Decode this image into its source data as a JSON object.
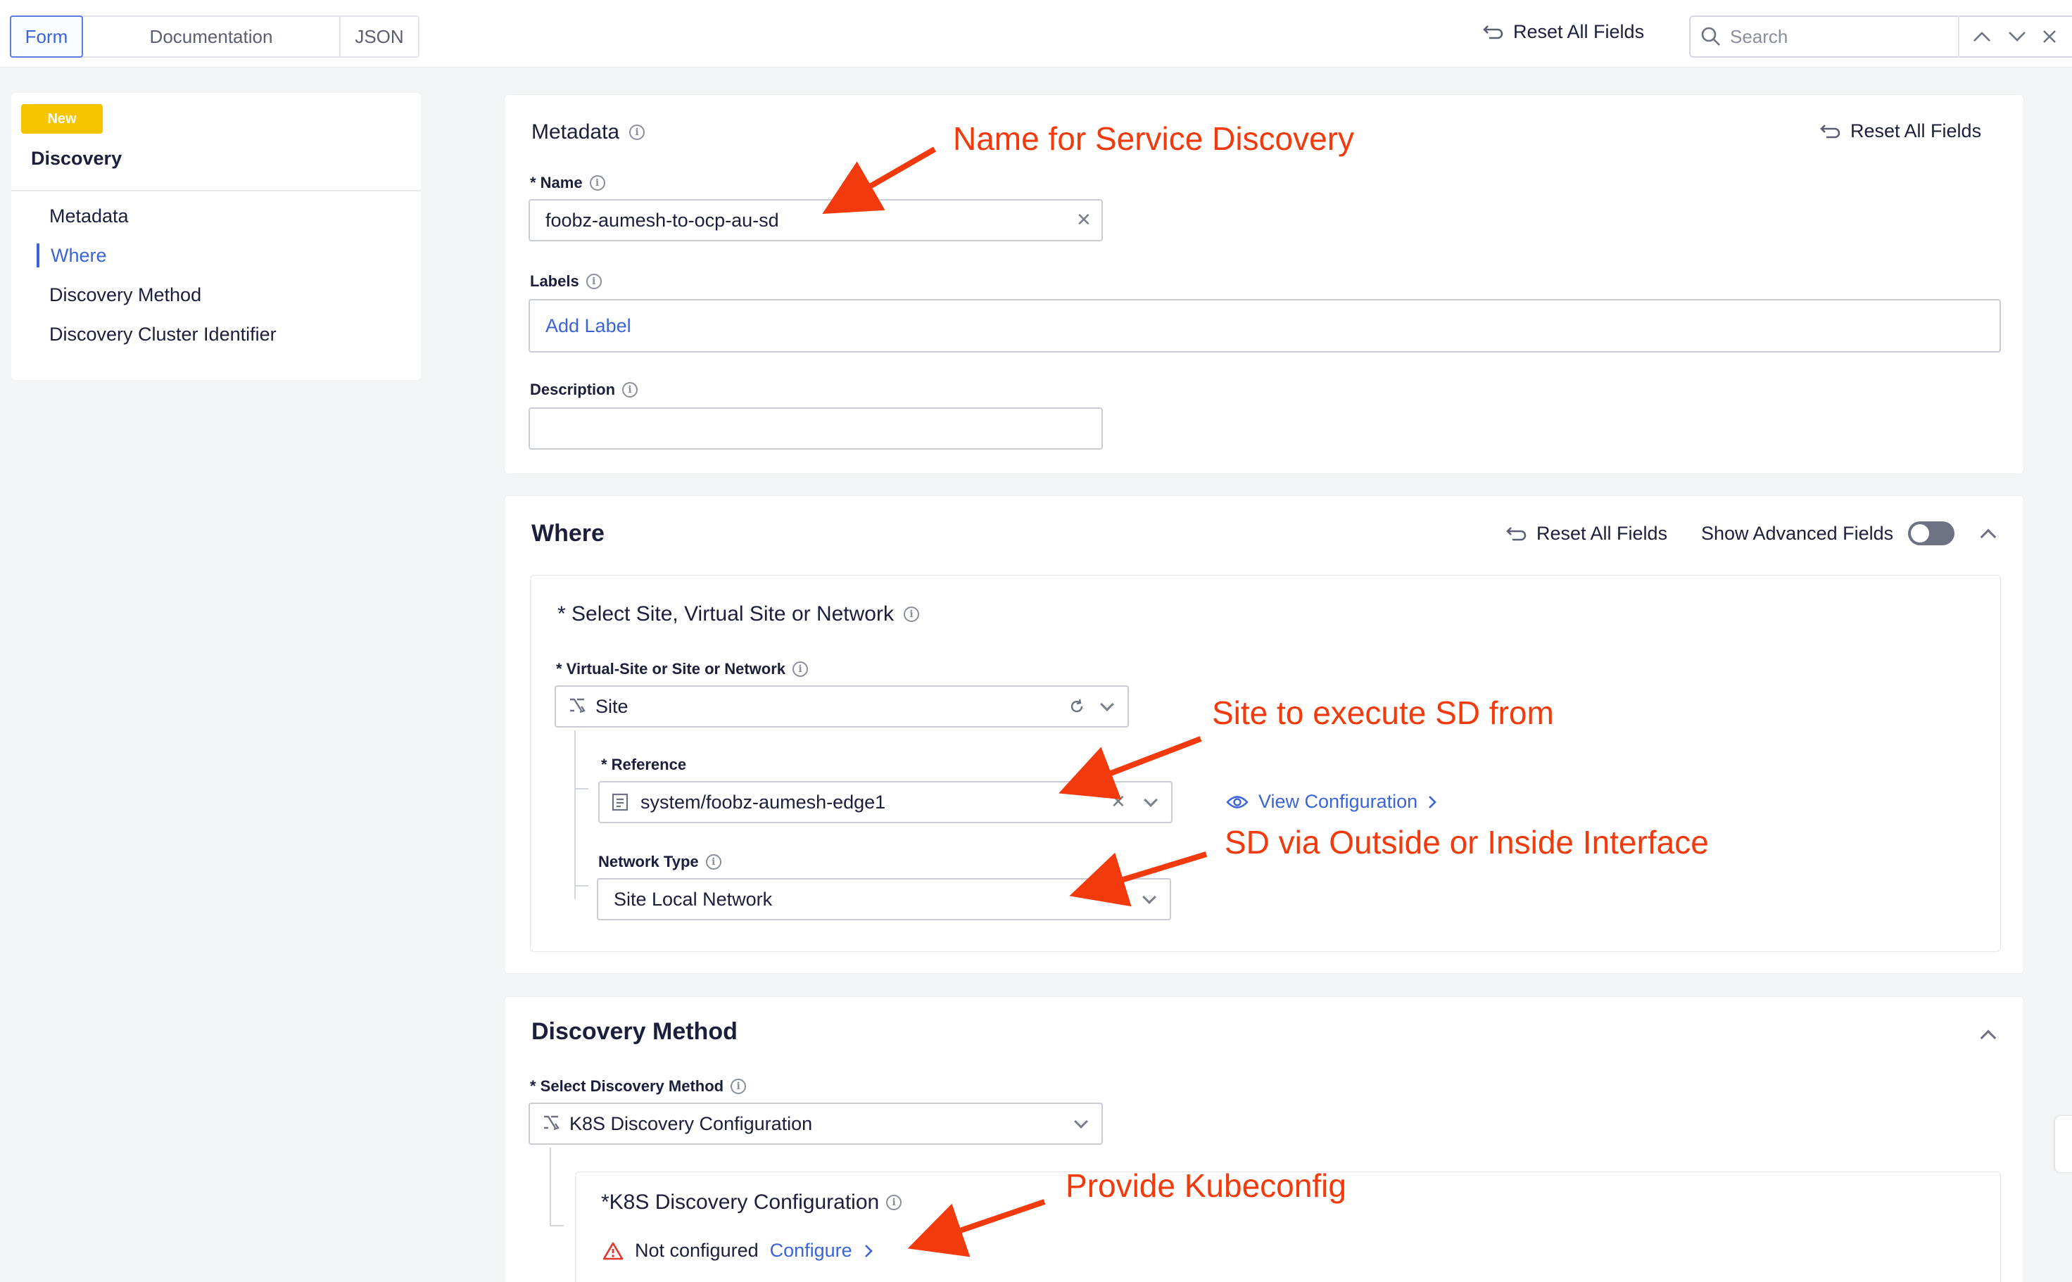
{
  "topbar": {
    "tabs": [
      "Form",
      "Documentation",
      "JSON"
    ],
    "active_tab": "Form",
    "reset_all_label": "Reset All Fields",
    "search_placeholder": "Search"
  },
  "sidebar": {
    "badge": "New",
    "title": "Discovery",
    "items": [
      "Metadata",
      "Where",
      "Discovery Method",
      "Discovery Cluster Identifier"
    ],
    "active_item": "Where"
  },
  "metadata": {
    "title": "Metadata",
    "reset_label": "Reset All Fields",
    "name_label": "* Name",
    "name_value": "foobz-aumesh-to-ocp-au-sd",
    "labels_label": "Labels",
    "labels_placeholder": "Add Label",
    "description_label": "Description",
    "description_value": ""
  },
  "where": {
    "title": "Where",
    "reset_label": "Reset All Fields",
    "advanced_label": "Show Advanced Fields",
    "advanced_enabled": false,
    "section_title": "* Select Site, Virtual Site or Network",
    "vsite_label": "* Virtual-Site or Site or Network",
    "vsite_value": "Site",
    "reference_label": "* Reference",
    "reference_value": "system/foobz-aumesh-edge1",
    "view_config_label": "View Configuration",
    "network_type_label": "Network Type",
    "network_type_value": "Site Local Network"
  },
  "discovery_method": {
    "title": "Discovery Method",
    "select_label": "* Select Discovery Method",
    "select_value": "K8S Discovery Configuration",
    "k8s_title": "*K8S Discovery Configuration",
    "status": "Not configured",
    "configure_label": "Configure"
  },
  "annotations": {
    "name": "Name for Service Discovery",
    "site": "Site to execute SD from",
    "network": "SD via Outside or Inside Interface",
    "kubeconfig": "Provide Kubeconfig"
  },
  "colors": {
    "accent": "#3a64d8",
    "annotation": "#f23a0c",
    "badge": "#f7c400",
    "warning": "#e2372b"
  }
}
